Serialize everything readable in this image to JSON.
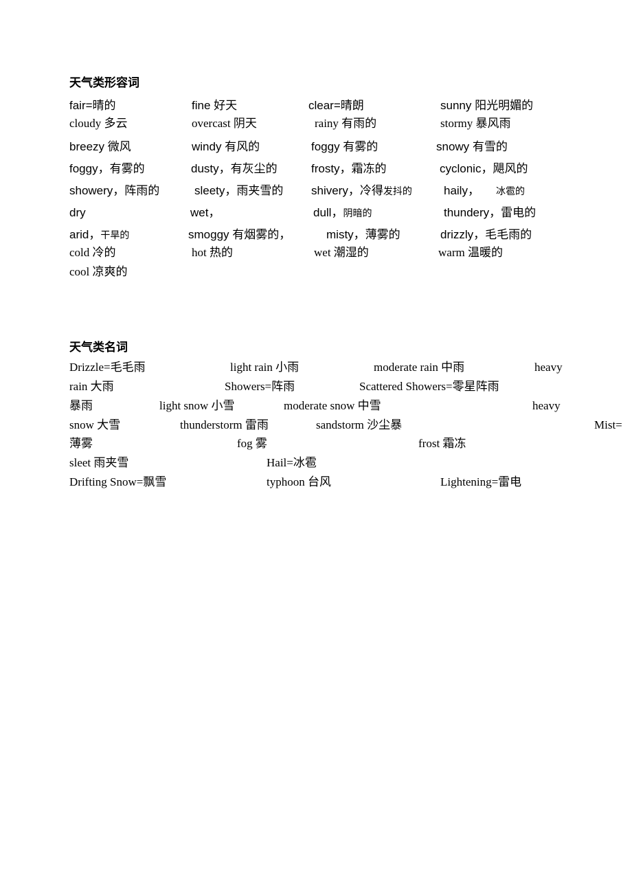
{
  "adjectives": {
    "heading": "天气类形容词",
    "rows": [
      [
        "fair=晴的",
        "fine  好天",
        "clear=晴朗",
        "sunny 阳光明媚的"
      ],
      [
        "cloudy 多云",
        "overcast 阴天",
        "rainy 有雨的",
        "stormy  暴风雨"
      ],
      [
        "breezy  微风",
        "windy 有风的",
        "foggy 有雾的",
        "snowy 有雪的"
      ],
      [
        "foggy，有雾的",
        "dusty，有灰尘的",
        "frosty，霜冻的",
        "cyclonic，飓风的"
      ],
      [
        "showery，阵雨的",
        "sleety，雨夹雪的",
        "shivery，冷得",
        "haily，"
      ],
      [
        "dry",
        "wet，",
        "dull，",
        "thundery，雷电的"
      ],
      [
        "arid，",
        "smoggy 有烟雾的，",
        "misty，薄雾的",
        "drizzly，毛毛雨的"
      ],
      [
        "cold 冷的",
        "hot 热的",
        "wet 潮湿的",
        "warm 温暖的"
      ],
      [
        "cool 凉爽的"
      ]
    ],
    "small_suffixes": {
      "shivery": "发抖的",
      "haily": "冰雹的",
      "dull": "阴暗的",
      "arid": "干旱的"
    }
  },
  "nouns": {
    "heading": "天气类名词",
    "items": [
      "Drizzle=毛毛雨",
      "light rain  小雨",
      "moderate rain  中雨",
      "heavy",
      "rain  大雨",
      "Showers=阵雨",
      "Scattered Showers=零星阵雨",
      "暴雨",
      "light snow  小雪",
      "moderate snow 中雪",
      "heavy",
      "snow  大雪",
      "thunderstorm 雷雨",
      "sandstorm  沙尘暴",
      "Mist=",
      "薄雾",
      "fog 雾",
      "frost 霜冻",
      "sleet  雨夹雪",
      "Hail=冰雹",
      "Drifting Snow=飘雪",
      "typhoon 台风",
      "Lightening=雷电"
    ]
  }
}
